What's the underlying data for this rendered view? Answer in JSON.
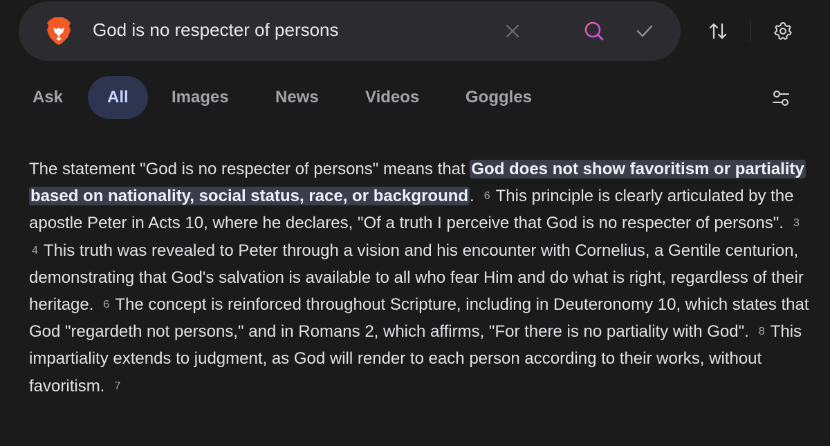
{
  "search": {
    "query": "God is no respecter of persons"
  },
  "tabs": [
    {
      "label": "Ask",
      "active": false
    },
    {
      "label": "All",
      "active": true
    },
    {
      "label": "Images",
      "active": false
    },
    {
      "label": "News",
      "active": false
    },
    {
      "label": "Videos",
      "active": false
    },
    {
      "label": "Goggles",
      "active": false
    }
  ],
  "icons": {
    "brand": "brave-lion-icon",
    "clear": "close-icon",
    "search": "search-icon",
    "confirm": "check-icon",
    "sort": "sort-icon",
    "settings": "gear-icon",
    "filters": "sliders-icon"
  },
  "colors": {
    "background": "#1b1b1c",
    "search_bar": "#2c2c30",
    "active_tab_bg": "#2d3550",
    "active_tab_text": "#c9d3ff",
    "highlight_bg": "#3a3d4a",
    "brand_orange": "#f25a26"
  },
  "answer": {
    "p1": "The statement \"God is no respecter of persons\" means that ",
    "highlight": "God does not show favoritism or partiality based on nationality, social status, race, or background",
    "p2": ".",
    "c1": "6",
    "p3": "This principle is clearly articulated by the apostle Peter in Acts 10, where he declares, \"Of a truth I perceive that God is no respecter of persons\".",
    "c2": "3",
    "c3": "4",
    "p4": "This truth was revealed to Peter through a vision and his encounter with Cornelius, a Gentile centurion, demonstrating that God's salvation is available to all who fear Him and do what is right, regardless of their heritage.",
    "c4": "6",
    "p5": "The concept is reinforced throughout Scripture, including in Deuteronomy 10, which states that God \"regardeth not persons,\" and in Romans 2, which affirms, \"For there is no partiality with God\".",
    "c5": "8",
    "p6": "This impartiality extends to judgment, as God will render to each person according to their works, without favoritism.",
    "c6": "7"
  }
}
